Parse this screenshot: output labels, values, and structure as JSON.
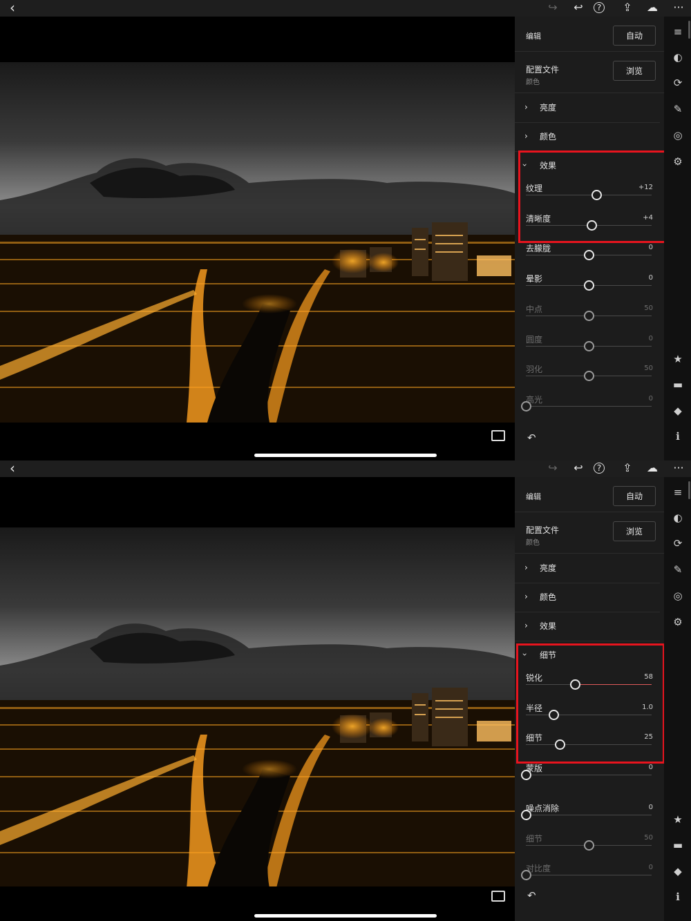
{
  "icons": {
    "back": "‹",
    "redo": "↪",
    "undo": "↩",
    "help": "?",
    "share": "⇪",
    "cloud": "☁",
    "more": "···",
    "rail": [
      "≡",
      "◐",
      "⟳",
      "✎",
      "◎",
      "⚙"
    ],
    "rail_bottom": [
      "★",
      "▬",
      "◆",
      "ℹ"
    ],
    "reset": "↶"
  },
  "colors": {
    "panel_bg": "#1c1c1c",
    "highlight": "#e8141e",
    "slider_fill": "#e05a5a"
  },
  "screens": [
    {
      "edit_label": "编辑",
      "auto_button": "自动",
      "profile_label": "配置文件",
      "profile_value": "颜色",
      "browse_button": "浏览",
      "sections": [
        {
          "label": "亮度",
          "expanded": false
        },
        {
          "label": "颜色",
          "expanded": false
        },
        {
          "label": "效果",
          "expanded": true
        }
      ],
      "sliders": [
        {
          "name": "纹理",
          "value": "+12",
          "pos": 0.56,
          "dim": false
        },
        {
          "name": "清晰度",
          "value": "+4",
          "pos": 0.52,
          "dim": false
        },
        {
          "name": "去朦胧",
          "value": "0",
          "pos": 0.5,
          "dim": false
        },
        {
          "name": "晕影",
          "value": "0",
          "pos": 0.5,
          "dim": false
        },
        {
          "name": "中点",
          "value": "50",
          "pos": 0.5,
          "dim": true
        },
        {
          "name": "圆度",
          "value": "0",
          "pos": 0.5,
          "dim": true
        },
        {
          "name": "羽化",
          "value": "50",
          "pos": 0.5,
          "dim": true
        },
        {
          "name": "高光",
          "value": "0",
          "pos": 0.0,
          "dim": true
        }
      ]
    },
    {
      "edit_label": "编辑",
      "auto_button": "自动",
      "profile_label": "配置文件",
      "profile_value": "颜色",
      "browse_button": "浏览",
      "sections": [
        {
          "label": "亮度",
          "expanded": false
        },
        {
          "label": "颜色",
          "expanded": false
        },
        {
          "label": "效果",
          "expanded": false
        },
        {
          "label": "细节",
          "expanded": true
        }
      ],
      "sliders": [
        {
          "name": "锐化",
          "value": "58",
          "pos": 0.39,
          "dim": false,
          "fill": true
        },
        {
          "name": "半径",
          "value": "1.0",
          "pos": 0.22,
          "dim": false
        },
        {
          "name": "细节",
          "value": "25",
          "pos": 0.27,
          "dim": false
        },
        {
          "name": "蒙版",
          "value": "0",
          "pos": 0.0,
          "dim": false
        },
        {
          "name": "噪点消除",
          "value": "0",
          "pos": 0.0,
          "dim": false
        },
        {
          "name": "细节",
          "value": "50",
          "pos": 0.5,
          "dim": true
        },
        {
          "name": "对比度",
          "value": "0",
          "pos": 0.0,
          "dim": true
        }
      ]
    }
  ]
}
